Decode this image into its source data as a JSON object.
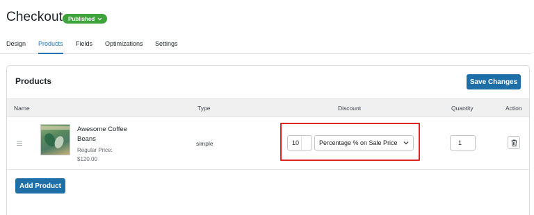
{
  "header": {
    "title": "Checkout",
    "status": "Published"
  },
  "tabs": [
    {
      "label": "Design",
      "active": false
    },
    {
      "label": "Products",
      "active": true
    },
    {
      "label": "Fields",
      "active": false
    },
    {
      "label": "Optimizations",
      "active": false
    },
    {
      "label": "Settings",
      "active": false
    }
  ],
  "products_card": {
    "title": "Products",
    "save_label": "Save Changes",
    "add_label": "Add Product",
    "columns": {
      "name": "Name",
      "type": "Type",
      "discount": "Discount",
      "quantity": "Quantity",
      "action": "Action"
    },
    "rows": [
      {
        "name": "Awesome Coffee Beans",
        "regular_price_label": "Regular Price:",
        "regular_price": "$120.00",
        "type": "simple",
        "discount_value": "10",
        "discount_type": "Percentage % on Sale Price",
        "quantity": "1"
      }
    ]
  },
  "colors": {
    "accent": "#2271b1",
    "primary_button": "#1e6fa8",
    "published_badge": "#3ea33a",
    "highlight": "#e02424"
  },
  "icons": {
    "status_dropdown": "chevron-down-icon",
    "drag": "drag-handle-icon",
    "select": "chevron-down-icon",
    "delete": "trash-icon"
  }
}
